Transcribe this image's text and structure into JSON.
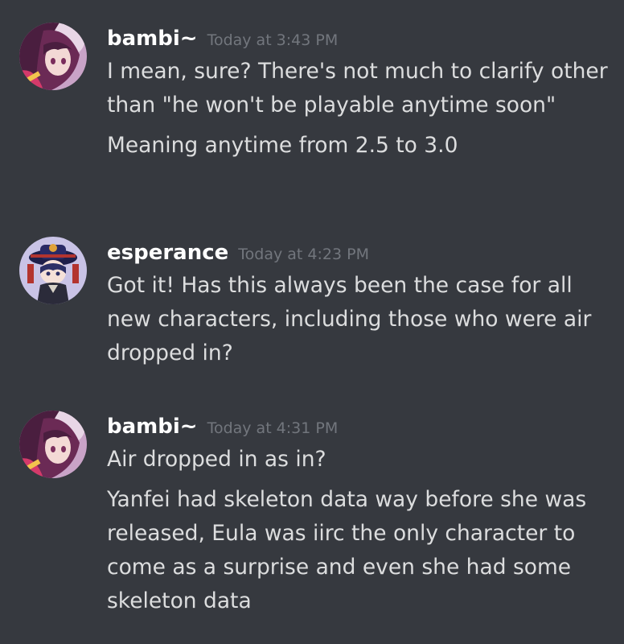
{
  "messages": [
    {
      "author": "bambi~",
      "timestamp": "Today at 3:43 PM",
      "avatar_icon": "anime-girl-avatar-icon",
      "lines": [
        "I mean, sure? There's not much to clarify other than \"he won't be playable anytime soon\"",
        "Meaning anytime from 2.5 to 3.0"
      ]
    },
    {
      "author": "esperance",
      "timestamp": "Today at 4:23 PM",
      "avatar_icon": "chibi-hat-avatar-icon",
      "lines": [
        "Got it! Has this always been the case for all new characters, including those who were air dropped in?"
      ]
    },
    {
      "author": "bambi~",
      "timestamp": "Today at 4:31 PM",
      "avatar_icon": "anime-girl-avatar-icon",
      "lines": [
        "Air dropped in as in?",
        "Yanfei had skeleton data way before she was released, Eula was iirc the only character to come as a surprise and even she had some skeleton data"
      ]
    }
  ],
  "colors": {
    "background": "#36393f",
    "username": "#ffffff",
    "timestamp": "#72767d",
    "text": "#dcddde"
  }
}
